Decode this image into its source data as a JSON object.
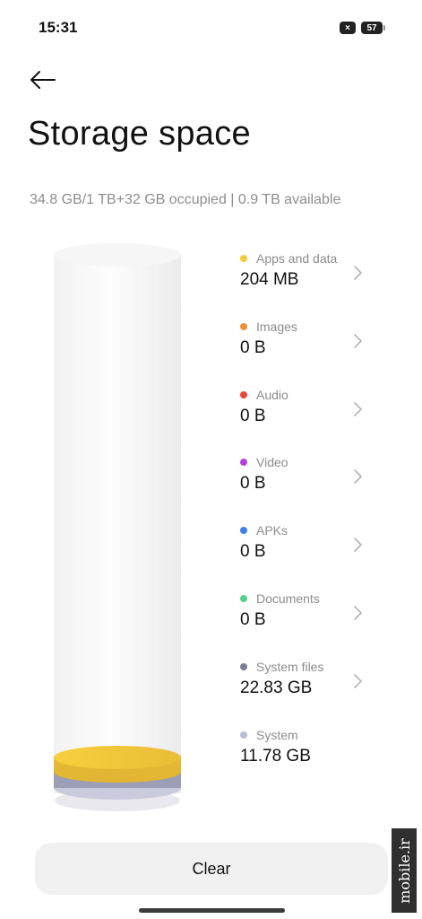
{
  "status_bar": {
    "time": "15:31",
    "notification_badge": "×",
    "battery": "57"
  },
  "header": {
    "back_icon": "arrow-left-icon",
    "title": "Storage space"
  },
  "summary": "34.8 GB/1 TB+32 GB occupied | 0.9 TB available",
  "categories": [
    {
      "label": "Apps and data",
      "value": "204 MB",
      "color": "#f3cb3b",
      "has_chevron": true
    },
    {
      "label": "Images",
      "value": "0 B",
      "color": "#f0913a",
      "has_chevron": true
    },
    {
      "label": "Audio",
      "value": "0 B",
      "color": "#ea4a3e",
      "has_chevron": true
    },
    {
      "label": "Video",
      "value": "0 B",
      "color": "#b43fd9",
      "has_chevron": true
    },
    {
      "label": "APKs",
      "value": "0 B",
      "color": "#3f7ef0",
      "has_chevron": true
    },
    {
      "label": "Documents",
      "value": "0 B",
      "color": "#55d089",
      "has_chevron": true
    },
    {
      "label": "System files",
      "value": "22.83 GB",
      "color": "#7b7f98",
      "has_chevron": true
    },
    {
      "label": "System",
      "value": "11.78 GB",
      "color": "#b9bcd4",
      "has_chevron": false
    }
  ],
  "actions": {
    "clear_label": "Clear"
  },
  "watermark": "mobile.ir"
}
